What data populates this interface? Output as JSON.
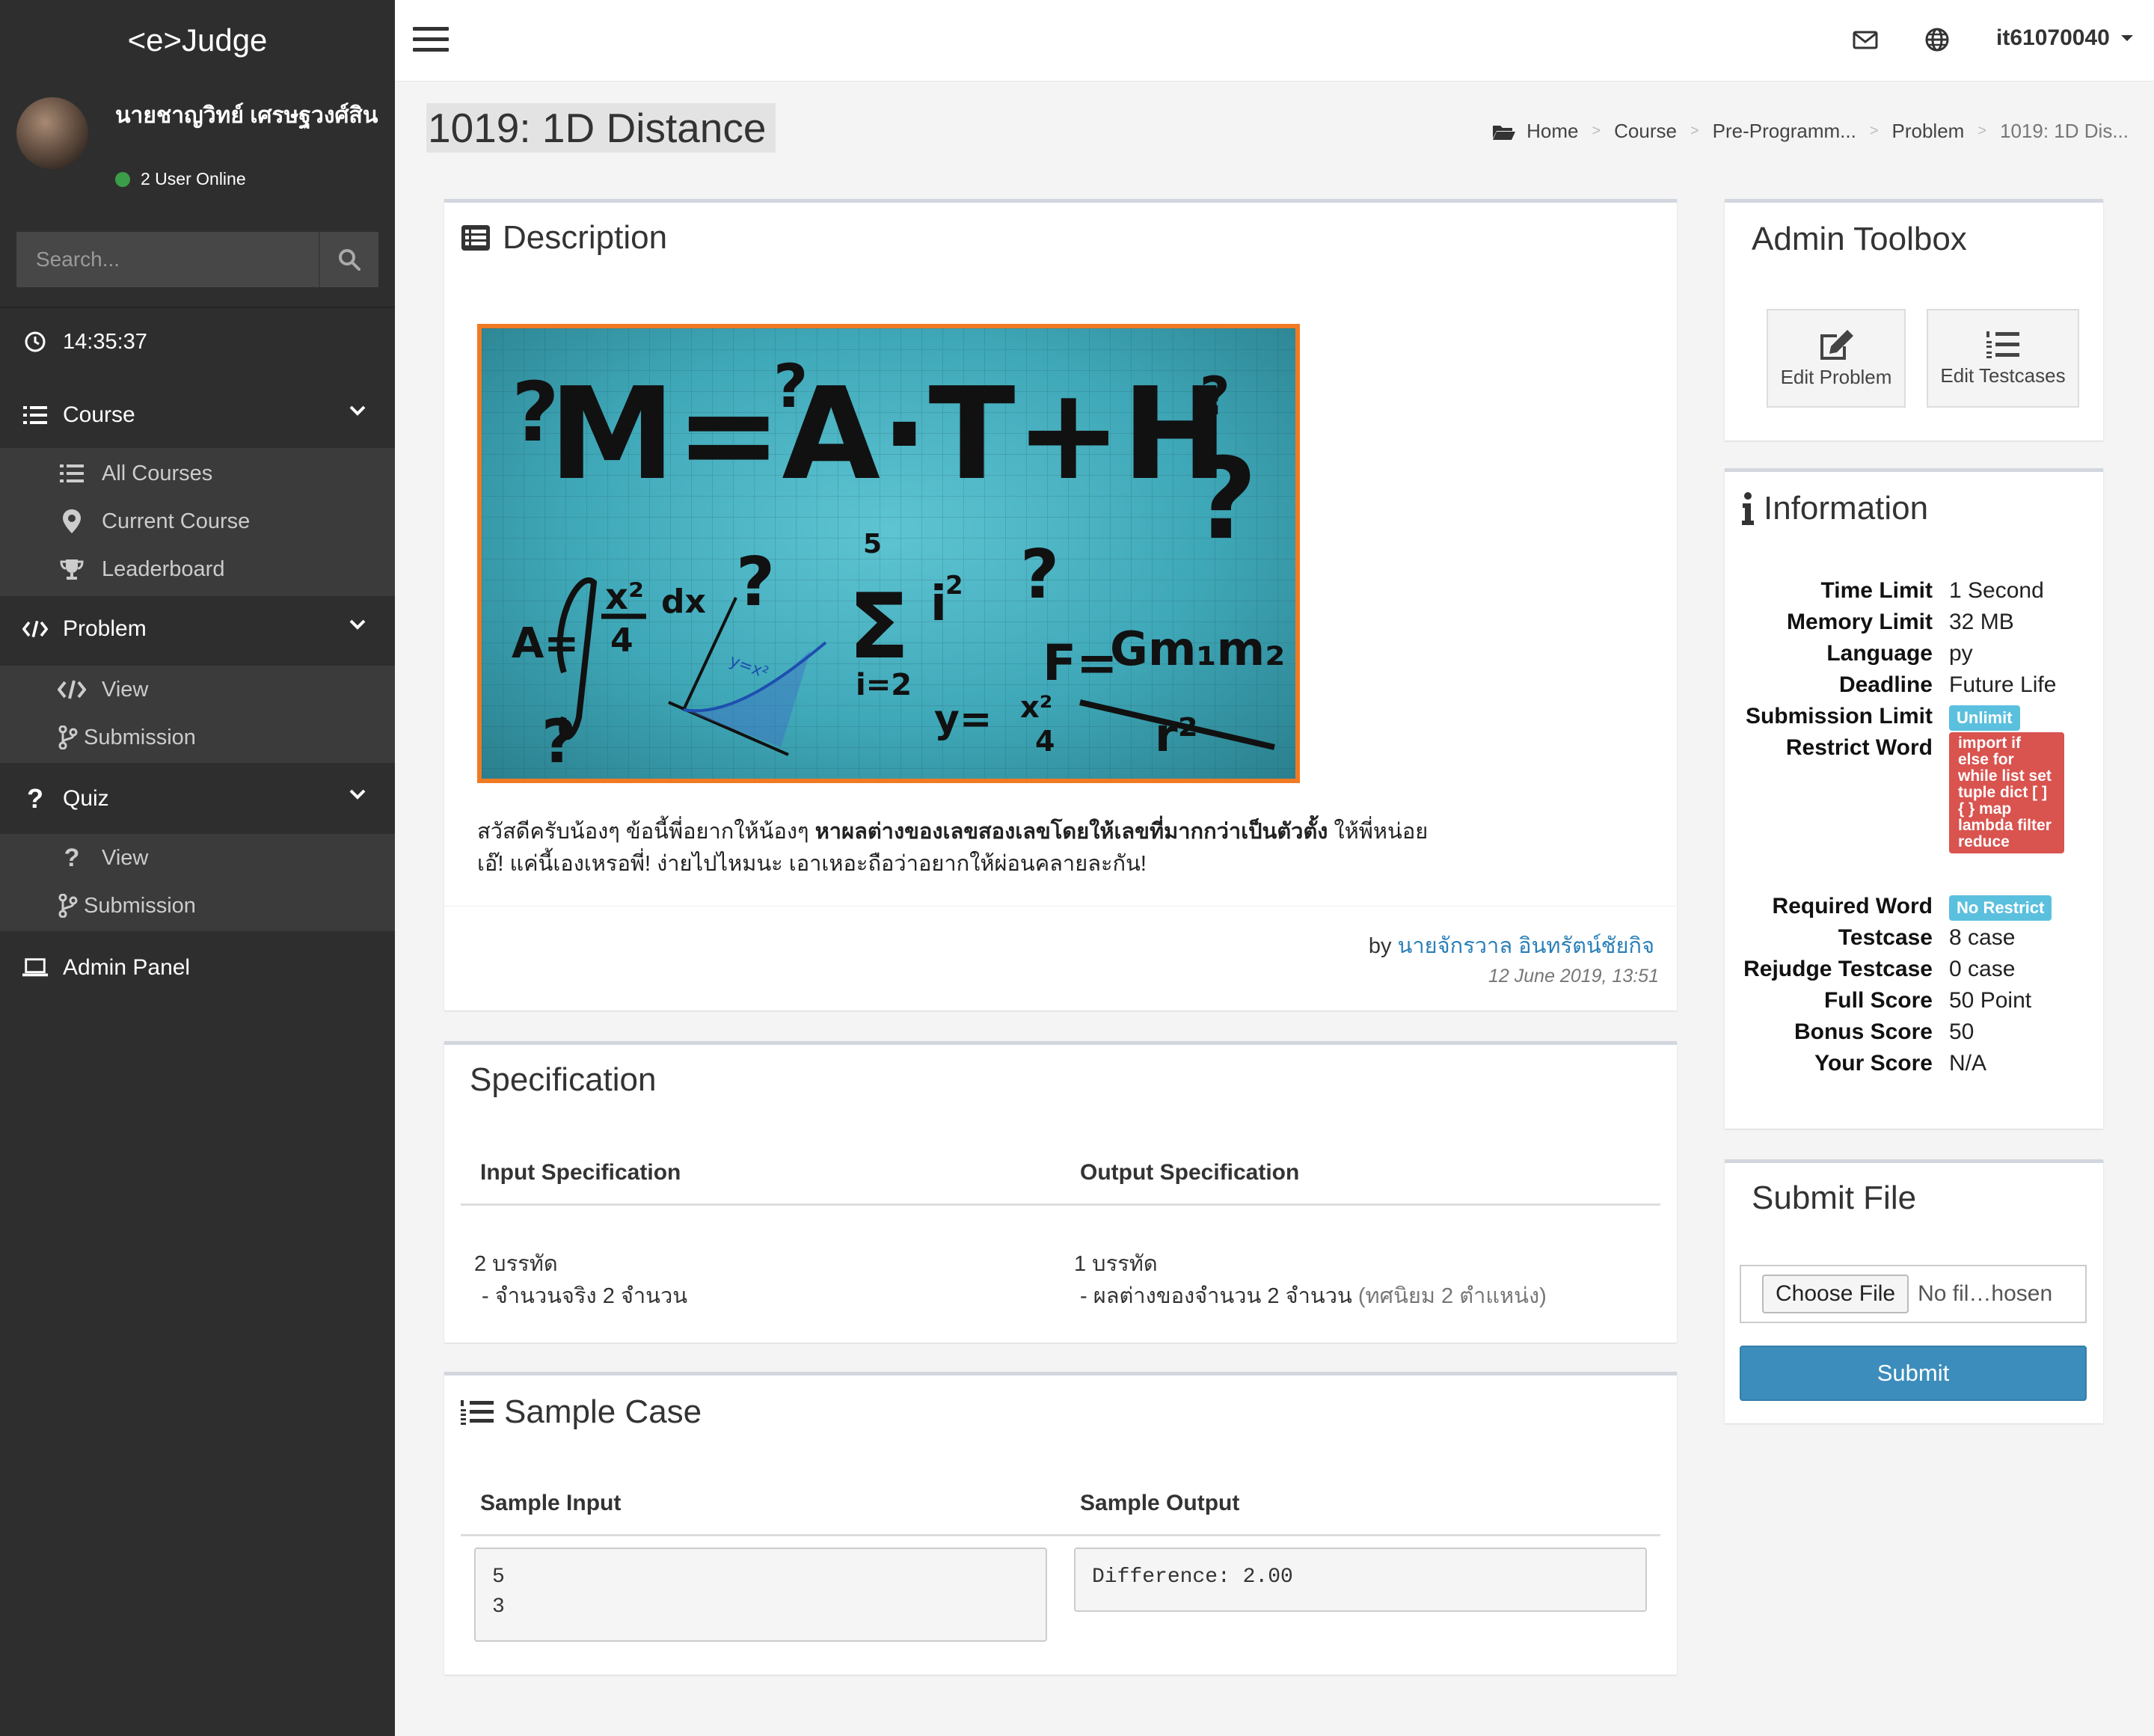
{
  "app": {
    "brand": "<e>Judge"
  },
  "user_panel": {
    "name": "นายชาญวิทย์ เศรษฐวงศ์สิน",
    "online_text": "2 User Online"
  },
  "search": {
    "placeholder": "Search..."
  },
  "clock": "14:35:37",
  "sidebar": {
    "course": {
      "label": "Course",
      "items": [
        "All Courses",
        "Current Course",
        "Leaderboard"
      ]
    },
    "problem": {
      "label": "Problem",
      "items": [
        "View",
        "Submission"
      ]
    },
    "quiz": {
      "label": "Quiz",
      "items": [
        "View",
        "Submission"
      ]
    },
    "admin": {
      "label": "Admin Panel"
    }
  },
  "topbar": {
    "username": "it61070040"
  },
  "page": {
    "title": "1019: 1D Distance",
    "breadcrumb": [
      "Home",
      "Course",
      "Pre-Programm...",
      "Problem",
      "1019: 1D Dis..."
    ]
  },
  "description": {
    "title": "Description",
    "text_part1": "สวัสดีครับน้องๆ ข้อนี้พี่อยากให้น้องๆ ",
    "text_bold": "หาผลต่างของเลขสองเลขโดยให้เลขที่มากกว่าเป็นตัวตั้ง",
    "text_part2": " ให้พี่หน่อย",
    "text_line2": "เอ๊! แค่นี้เองเหรอพี่! ง่ายไปไหมนะ เอาเหอะถือว่าอยากให้ผ่อนคลายละกัน!",
    "by_prefix": "by ",
    "author": "นายจักรวาล อินทรัตน์ชัยกิจ",
    "date": "12 June 2019, 13:51"
  },
  "specification": {
    "title": "Specification",
    "input_header": "Input Specification",
    "output_header": "Output Specification",
    "input_line1": "2 บรรทัด",
    "input_line2": "-  จำนวนจริง 2 จำนวน",
    "output_line1": "1 บรรทัด",
    "output_line2": "- ผลต่างของจำนวน 2 จำนวน",
    "output_line2_muted": " (ทศนิยม 2 ตำแหน่ง)"
  },
  "sample": {
    "title": "Sample Case",
    "input_header": "Sample Input",
    "output_header": "Sample Output",
    "input_value": "5\n3",
    "output_value": "Difference: 2.00"
  },
  "admin_toolbox": {
    "title": "Admin Toolbox",
    "edit_problem": "Edit Problem",
    "edit_testcases": "Edit Testcases"
  },
  "information": {
    "title": "Information",
    "rows": [
      {
        "key": "Time Limit",
        "value": "1 Second"
      },
      {
        "key": "Memory Limit",
        "value": "32 MB"
      },
      {
        "key": "Language",
        "value": "py"
      },
      {
        "key": "Deadline",
        "value": "Future Life"
      },
      {
        "key": "Submission Limit",
        "value": "Unlimit"
      },
      {
        "key": "Restrict Word",
        "value": "import if else for while list set tuple dict [ ] { } map lambda filter reduce"
      },
      {
        "key": "Required Word",
        "value": "No Restrict"
      },
      {
        "key": "Testcase",
        "value": "8 case"
      },
      {
        "key": "Rejudge Testcase",
        "value": "0 case"
      },
      {
        "key": "Full Score",
        "value": "50 Point"
      },
      {
        "key": "Bonus Score",
        "value": "50"
      },
      {
        "key": "Your Score",
        "value": "N/A"
      }
    ]
  },
  "submit_file": {
    "title": "Submit File",
    "choose_label": "Choose File",
    "file_name": "No fil…hosen",
    "submit_label": "Submit"
  },
  "image_text": {
    "headline": "M=A·T+H"
  },
  "colors": {
    "sidebar_bg": "#2e2e2e",
    "accent": "#3c8dbc",
    "badge_info": "#5bc0de",
    "badge_danger": "#d9534f",
    "image_border": "#f07a24"
  }
}
